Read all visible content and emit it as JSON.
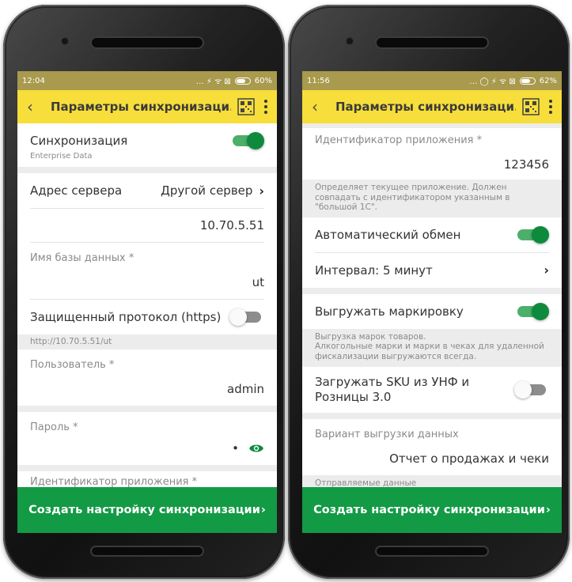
{
  "colors": {
    "appbar": "#f7de3b",
    "statusbar": "#a99a4d",
    "accent_green": "#0e8a3c",
    "cta": "#139a45"
  },
  "left": {
    "status": {
      "time": "12:04",
      "icons": "… ⚡ ᯤ ⊠",
      "battery": "60%"
    },
    "appbar": {
      "back_icon": "arrow-left-icon",
      "title": "Параметры синхронизаци...",
      "qr_icon": "qr-code-icon",
      "more_icon": "more-vert-icon"
    },
    "sync": {
      "label": "Синхронизация",
      "sub": "Enterprise Data",
      "on": true
    },
    "server": {
      "label": "Адрес сервера",
      "choice": "Другой сервер",
      "address": "10.70.5.51"
    },
    "db": {
      "label": "Имя базы данных *",
      "value": "ut"
    },
    "https": {
      "label": "Защищенный протокол (https)",
      "on": false,
      "url": "http://10.70.5.51/ut"
    },
    "user": {
      "label": "Пользователь *",
      "value": "admin"
    },
    "password": {
      "label": "Пароль *",
      "value": "•"
    },
    "app_id": {
      "label": "Идентификатор приложения *"
    },
    "cta": {
      "label": "Создать настройку синхронизации",
      "arrow": "›"
    }
  },
  "right": {
    "status": {
      "time": "11:56",
      "icons": "… ◯ ⚡ ᯤ ⊠",
      "battery": "62%"
    },
    "appbar": {
      "back_icon": "arrow-left-icon",
      "title": "Параметры синхронизаци...",
      "qr_icon": "qr-code-icon",
      "more_icon": "more-vert-icon"
    },
    "app_id": {
      "label": "Идентификатор приложения *",
      "value": "123456",
      "hint": "Определяет текущее приложение. Должен совпадать с идентификатором указанным в \"большой 1С\"."
    },
    "auto_exchange": {
      "label": "Автоматический обмен",
      "on": true
    },
    "interval": {
      "label": "Интервал: 5 минут"
    },
    "marking": {
      "label": "Выгружать маркировку",
      "on": true,
      "hint": "Выгрузка марок товаров.\nАлкогольные марки и марки в чеках для удаленной фискализации выгружаются всегда."
    },
    "sku": {
      "label": "Загружать SKU из УНФ и Розницы 3.0",
      "on": false
    },
    "variant": {
      "label": "Вариант выгрузки данных",
      "value": "Отчет о продажах и чеки"
    },
    "sent": {
      "label": "Отправляемые данные"
    },
    "cta": {
      "label": "Создать настройку синхронизации",
      "arrow": "›"
    }
  }
}
